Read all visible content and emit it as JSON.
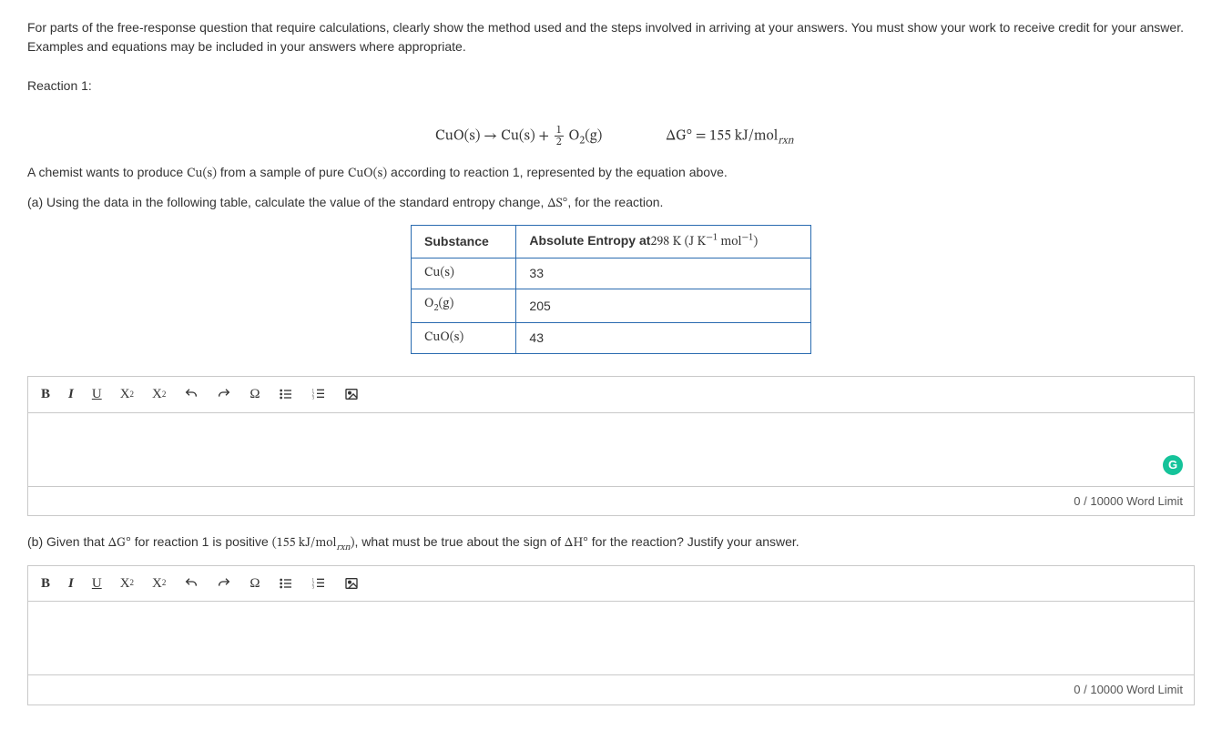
{
  "instructions": "For parts of the free-response question that require calculations, clearly show the method used and the steps involved in arriving at your answers. You must show your work to receive credit for your answer. Examples and equations may be included in your answers where appropriate.",
  "reaction_label": "Reaction 1:",
  "equation": {
    "lhs": "CuO(s) → Cu(s) + ",
    "frac_num": "1",
    "frac_den": "2",
    "after_frac": " O",
    "o2_sub": "2",
    "o2_tail": "(g)",
    "dg_prefix": "ΔG° = 155 kJ/mol",
    "dg_sub": "rxn"
  },
  "chemist_line": {
    "p1": "A chemist wants to produce ",
    "f1": "Cu(s)",
    "p2": " from a sample of pure ",
    "f2": "CuO(s)",
    "p3": " according to reaction 1, represented by the equation above."
  },
  "part_a": {
    "p1": "(a) Using the data in the following table, calculate the value of the standard entropy change, ",
    "sym": "ΔS°",
    "p2": ", for the reaction."
  },
  "table": {
    "head_substance": "Substance",
    "head_entropy_1": "Absolute Entropy at",
    "head_entropy_2": "298 K (J K",
    "head_entropy_sup1": "−1",
    "head_entropy_3": " mol",
    "head_entropy_sup2": "−1",
    "head_entropy_4": ")",
    "rows": [
      {
        "sub": "Cu(s)",
        "abbr": "Cu(s)",
        "val": "33"
      },
      {
        "sub": "O2(g)",
        "abbr": "O",
        "abbr_sub": "2",
        "abbr_tail": "(g)",
        "val": "205"
      },
      {
        "sub": "CuO(s)",
        "abbr": "CuO(s)",
        "val": "43"
      }
    ]
  },
  "part_b": {
    "p1": "(b) Given that ",
    "s1": "ΔG°",
    "p2": " for reaction 1 is positive ",
    "paren1": "(155 kJ/mol",
    "paren_sub": "rxn",
    "paren2": ")",
    "p3": ", what must be true about the sign of ",
    "s2": "ΔH°",
    "p4": " for the reaction? Justify your answer."
  },
  "toolbar": {
    "bold": "B",
    "italic": "I",
    "underline": "U",
    "sup_base": "X",
    "sup_exp": "2",
    "sub_base": "X",
    "sub_exp": "2",
    "omega": "Ω"
  },
  "editor": {
    "word_limit_a": "0 / 10000 Word Limit",
    "word_limit_b": "0 / 10000 Word Limit",
    "grammarly": "G"
  },
  "chart_data": {
    "type": "table",
    "title": "Absolute Entropy at 298 K (J K⁻¹ mol⁻¹)",
    "categories": [
      "Cu(s)",
      "O2(g)",
      "CuO(s)"
    ],
    "values": [
      33,
      205,
      43
    ]
  }
}
